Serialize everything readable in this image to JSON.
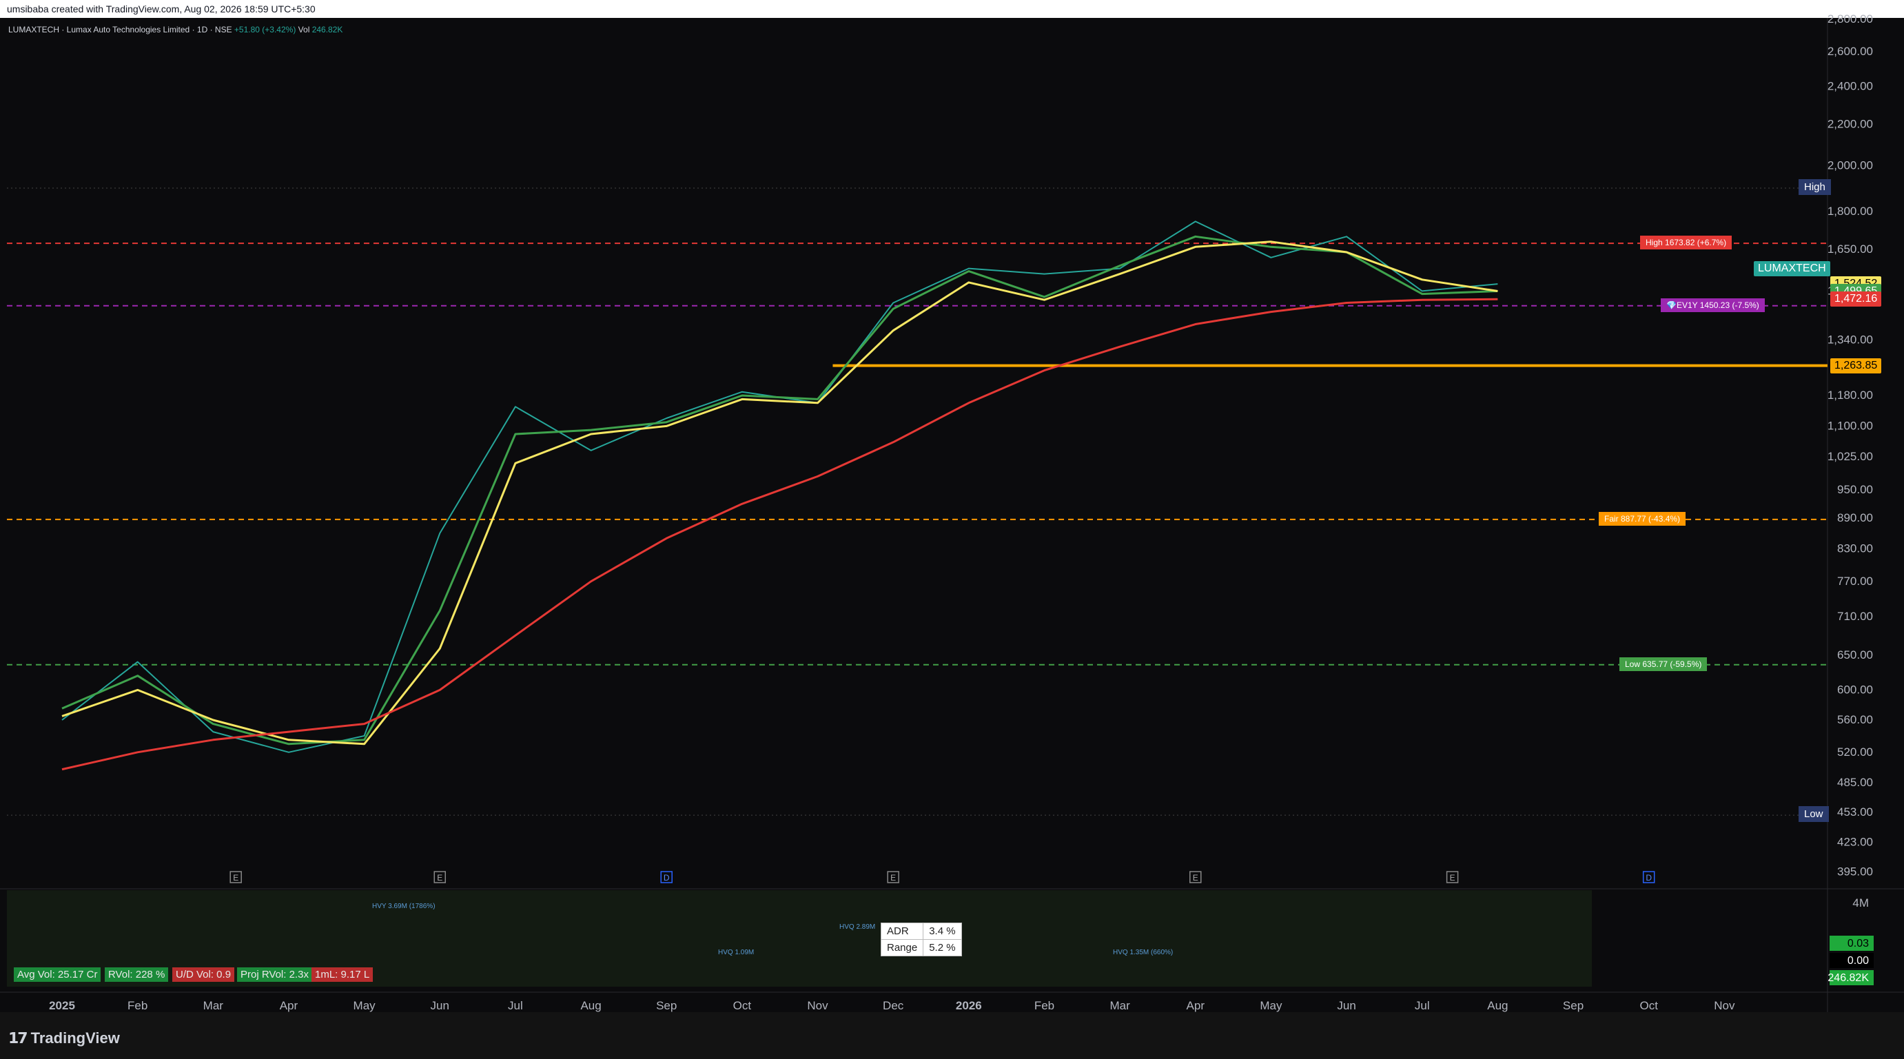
{
  "header": {
    "attribution": "umsibaba created with TradingView.com, Aug 02, 2026 18:59 UTC+5:30"
  },
  "legend": {
    "symbol_line": "LUMAXTECH · Lumax Auto Technologies Limited · 1D · NSE",
    "change": "+51.80 (+3.42%)",
    "volume_label": "Vol",
    "volume_value": "246.82K"
  },
  "chart_data": {
    "type": "line",
    "title": "LUMAXTECH · Lumax Auto Technologies Limited · 1D · NSE",
    "xlabel": "",
    "ylabel": "",
    "y_scale": "log",
    "ylim": [
      380,
      2800
    ],
    "y_ticks": [
      "2,800.00",
      "2,600.00",
      "2,400.00",
      "2,200.00",
      "2,000.00",
      "1,800.00",
      "1,650.00",
      "1,500.00",
      "1,340.00",
      "1,180.00",
      "1,100.00",
      "1,025.00",
      "950.00",
      "890.00",
      "830.00",
      "770.00",
      "710.00",
      "650.00",
      "600.00",
      "560.00",
      "520.00",
      "485.00",
      "453.00",
      "423.00",
      "395.00"
    ],
    "y_tick_values": [
      2800,
      2600,
      2400,
      2200,
      2000,
      1800,
      1650,
      1500,
      1340,
      1180,
      1100,
      1025,
      950,
      890,
      830,
      770,
      710,
      650,
      600,
      560,
      520,
      485,
      453,
      423,
      395
    ],
    "x_ticks": [
      "2025",
      "Feb",
      "Mar",
      "Apr",
      "May",
      "Jun",
      "Jul",
      "Aug",
      "Sep",
      "Oct",
      "Nov",
      "Dec",
      "2026",
      "Feb",
      "Mar",
      "Apr",
      "May",
      "Jun",
      "Jul",
      "Aug",
      "Sep",
      "Oct",
      "Nov"
    ],
    "x_tick_bold": [
      true,
      false,
      false,
      false,
      false,
      false,
      false,
      false,
      false,
      false,
      false,
      false,
      true,
      false,
      false,
      false,
      false,
      false,
      false,
      false,
      false,
      false,
      false
    ],
    "grid": false,
    "series": [
      {
        "name": "price",
        "color": "#26a69a",
        "x": [
          "2025-01",
          "2025-02",
          "2025-03",
          "2025-04",
          "2025-05",
          "2025-06",
          "2025-07",
          "2025-08",
          "2025-09",
          "2025-10",
          "2025-11",
          "2025-12",
          "2026-01",
          "2026-02",
          "2026-03",
          "2026-04",
          "2026-05",
          "2026-06",
          "2026-07",
          "2026-08"
        ],
        "values": [
          560,
          640,
          545,
          520,
          540,
          860,
          1150,
          1040,
          1120,
          1190,
          1160,
          1460,
          1580,
          1560,
          1580,
          1760,
          1620,
          1700,
          1500,
          1524.52
        ]
      },
      {
        "name": "fast ma",
        "color": "#3fa34d",
        "x": [
          "2025-01",
          "2025-02",
          "2025-03",
          "2025-04",
          "2025-05",
          "2025-06",
          "2025-07",
          "2025-08",
          "2025-09",
          "2025-10",
          "2025-11",
          "2025-12",
          "2026-01",
          "2026-02",
          "2026-03",
          "2026-04",
          "2026-05",
          "2026-06",
          "2026-07",
          "2026-08"
        ],
        "values": [
          575,
          620,
          555,
          530,
          535,
          720,
          1080,
          1090,
          1110,
          1180,
          1170,
          1440,
          1570,
          1480,
          1590,
          1700,
          1660,
          1640,
          1490,
          1499.65
        ]
      },
      {
        "name": "mid ma",
        "color": "#f5e663",
        "x": [
          "2025-01",
          "2025-02",
          "2025-03",
          "2025-04",
          "2025-05",
          "2025-06",
          "2025-07",
          "2025-08",
          "2025-09",
          "2025-10",
          "2025-11",
          "2025-12",
          "2026-01",
          "2026-02",
          "2026-03",
          "2026-04",
          "2026-05",
          "2026-06",
          "2026-07",
          "2026-08"
        ],
        "values": [
          565,
          600,
          560,
          535,
          530,
          660,
          1010,
          1080,
          1100,
          1170,
          1160,
          1370,
          1530,
          1470,
          1560,
          1660,
          1680,
          1640,
          1540,
          1499.65
        ]
      },
      {
        "name": "slow ma",
        "color": "#e53935",
        "x": [
          "2025-01",
          "2025-02",
          "2025-03",
          "2025-04",
          "2025-05",
          "2025-06",
          "2025-07",
          "2025-08",
          "2025-09",
          "2025-10",
          "2025-11",
          "2025-12",
          "2026-01",
          "2026-02",
          "2026-03",
          "2026-04",
          "2026-05",
          "2026-06",
          "2026-07",
          "2026-08"
        ],
        "values": [
          500,
          520,
          535,
          545,
          555,
          600,
          680,
          770,
          850,
          920,
          980,
          1060,
          1160,
          1250,
          1320,
          1390,
          1430,
          1460,
          1470,
          1472.16
        ]
      }
    ],
    "levels": {
      "high_52w": {
        "label": "High 1673.82 (+6.7%)",
        "value": 1673.82,
        "color": "#e53935"
      },
      "ev1y": {
        "label": "💎EV1Y 1450.23 (-7.5%)",
        "value": 1450.23,
        "color": "#9c27b0"
      },
      "fair": {
        "label": "Fair 887.77 (-43.4%)",
        "value": 887.77,
        "color": "#ff9800"
      },
      "low_52w": {
        "label": "Low 635.77 (-59.5%)",
        "value": 635.77,
        "color": "#43a047"
      },
      "support": {
        "value": 1263.85,
        "color": "#f7a600"
      },
      "all_time_high_marker": {
        "label": "High",
        "value": 1900
      },
      "all_time_low_marker": {
        "label": "Low",
        "value": 450
      }
    },
    "price_tags": [
      {
        "text": "LUMAXTECH",
        "value": 1580,
        "bg": "#26a69a",
        "fg": "#ffffff"
      },
      {
        "text": "1,524.52",
        "value": 1524.52,
        "bg": "#f5e663",
        "fg": "#000000"
      },
      {
        "text": "1,499.65",
        "value": 1499.65,
        "bg": "#3fa34d",
        "fg": "#ffffff"
      },
      {
        "text": "1,472.16",
        "value": 1472.16,
        "bg": "#e53935",
        "fg": "#ffffff"
      },
      {
        "text": "1,263.85",
        "value": 1263.85,
        "bg": "#f7a600",
        "fg": "#000000"
      }
    ],
    "earnings_markers": [
      "E",
      "E",
      "D",
      "E",
      "E",
      "E",
      "D"
    ],
    "volume_pane": {
      "axis_ticks": [
        "4M"
      ],
      "right_values": [
        "0.03",
        "0.00",
        "246.82K"
      ],
      "hvy_labels": [
        "HVY 3.69M (1786%)",
        "HVQ 2.89M",
        "HVQ 1.09M",
        "HVQ 1.35M (660%)"
      ]
    }
  },
  "stats": {
    "avg_vol": "Avg Vol: 25.17 Cr",
    "rvol": "RVol: 228 %",
    "ud_vol": "U/D Vol: 0.9",
    "proj_rvol": "Proj RVol: 2.3x",
    "one_ml": "1mL: 9.17 L"
  },
  "adr_table": {
    "adr_label": "ADR",
    "adr_value": "3.4 %",
    "range_label": "Range",
    "range_value": "5.2 %"
  },
  "footer": {
    "brand": "TradingView"
  },
  "colors": {
    "up": "#26a69a",
    "down": "#ef5350",
    "background": "#0b0b0d",
    "accent_purple": "#9c27b0"
  }
}
